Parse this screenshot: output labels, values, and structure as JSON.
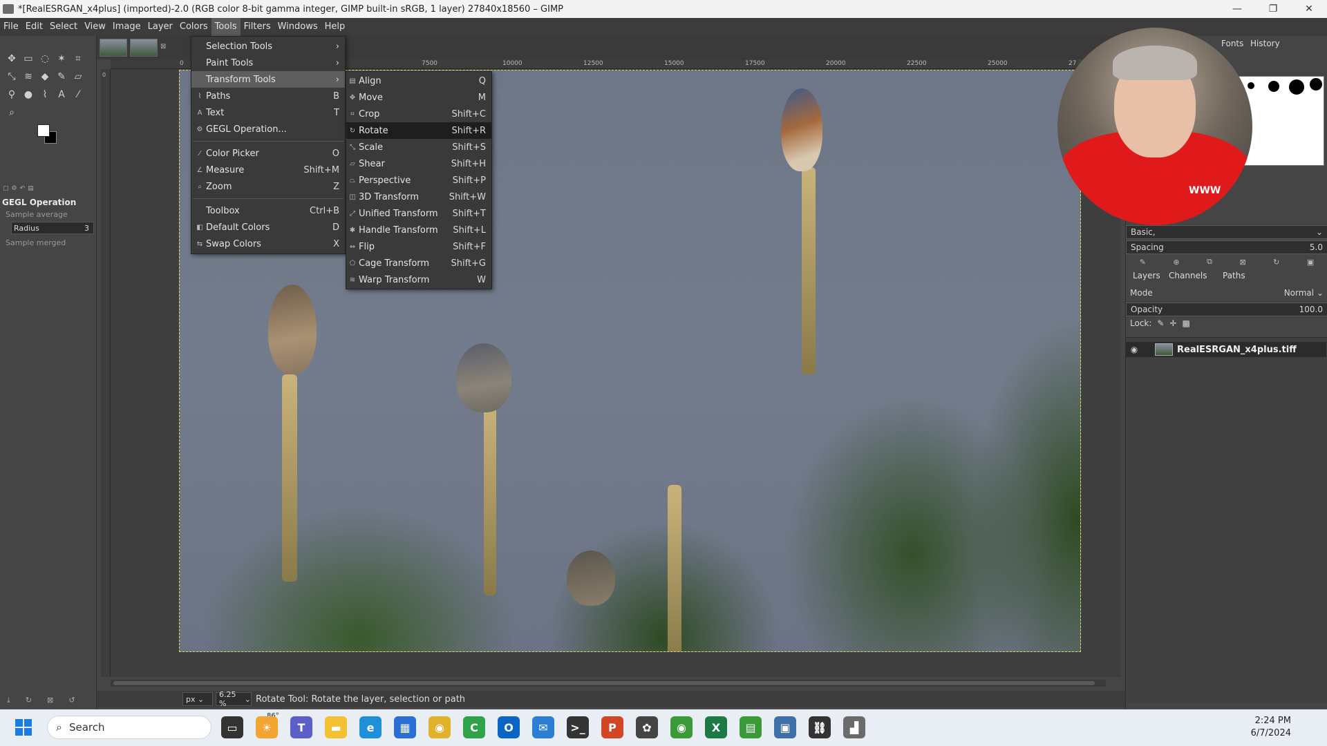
{
  "window": {
    "title": "*[RealESRGAN_x4plus] (imported)-2.0 (RGB color 8-bit gamma integer, GIMP built-in sRGB, 1 layer) 27840x18560 – GIMP",
    "minimize_icon": "minimize-icon",
    "maximize_icon": "restore-icon",
    "close_icon": "close-icon"
  },
  "menubar": [
    "File",
    "Edit",
    "Select",
    "View",
    "Image",
    "Layer",
    "Colors",
    "Tools",
    "Filters",
    "Windows",
    "Help"
  ],
  "tools_menu": {
    "items": [
      {
        "label": "Selection Tools",
        "shortcut": "",
        "submenu": true
      },
      {
        "label": "Paint Tools",
        "shortcut": "",
        "submenu": true
      },
      {
        "label": "Transform Tools",
        "shortcut": "",
        "submenu": true,
        "highlighted": true
      },
      {
        "label": "Paths",
        "shortcut": "B"
      },
      {
        "label": "Text",
        "shortcut": "T"
      },
      {
        "label": "GEGL Operation...",
        "shortcut": ""
      },
      {
        "label": "Color Picker",
        "shortcut": "O"
      },
      {
        "label": "Measure",
        "shortcut": "Shift+M"
      },
      {
        "label": "Zoom",
        "shortcut": "Z"
      },
      {
        "label": "Toolbox",
        "shortcut": "Ctrl+B"
      },
      {
        "label": "Default Colors",
        "shortcut": "D"
      },
      {
        "label": "Swap Colors",
        "shortcut": "X"
      }
    ]
  },
  "transform_menu": {
    "items": [
      {
        "label": "Align",
        "shortcut": "Q"
      },
      {
        "label": "Move",
        "shortcut": "M"
      },
      {
        "label": "Crop",
        "shortcut": "Shift+C"
      },
      {
        "label": "Rotate",
        "shortcut": "Shift+R",
        "highlighted": true
      },
      {
        "label": "Scale",
        "shortcut": "Shift+S"
      },
      {
        "label": "Shear",
        "shortcut": "Shift+H"
      },
      {
        "label": "Perspective",
        "shortcut": "Shift+P"
      },
      {
        "label": "3D Transform",
        "shortcut": "Shift+W"
      },
      {
        "label": "Unified Transform",
        "shortcut": "Shift+T"
      },
      {
        "label": "Handle Transform",
        "shortcut": "Shift+L"
      },
      {
        "label": "Flip",
        "shortcut": "Shift+F"
      },
      {
        "label": "Cage Transform",
        "shortcut": "Shift+G"
      },
      {
        "label": "Warp Transform",
        "shortcut": "W"
      }
    ]
  },
  "tool_options": {
    "title": "GEGL Operation",
    "sample_average": "Sample average",
    "radius_label": "Radius",
    "radius_value": "3",
    "sample_merged": "Sample merged"
  },
  "ruler_ticks": [
    "0",
    "7500",
    "10000",
    "12500",
    "15000",
    "17500",
    "20000",
    "22500",
    "25000",
    "27"
  ],
  "ruler_left_zero": "0",
  "statusbar": {
    "unit": "px",
    "zoom": "6.25 %",
    "message": "Rotate Tool: Rotate the layer, selection or path"
  },
  "right_dock": {
    "tab_fonts": "Fonts",
    "tab_history": "History",
    "brush_preset": "Basic,",
    "spacing_label": "Spacing",
    "spacing_value": "5.0",
    "tab_layers": "Layers",
    "tab_channels": "Channels",
    "tab_paths": "Paths",
    "mode_label": "Mode",
    "mode_value": "Normal",
    "opacity_label": "Opacity",
    "opacity_value": "100.0",
    "lock_label": "Lock:",
    "layer_name": "RealESRGAN_x4plus.tiff"
  },
  "webcam": {
    "shirt_logo": "WWW"
  },
  "taskbar": {
    "search_placeholder": "Search",
    "weather": "86°",
    "time": "2:24 PM",
    "date": "6/7/2024",
    "apps": [
      {
        "name": "task-view-icon",
        "color": "#333333",
        "glyph": "▭"
      },
      {
        "name": "weather-icon",
        "color": "#f3a533",
        "glyph": "☀"
      },
      {
        "name": "teams-icon",
        "color": "#5b5fc7",
        "glyph": "T"
      },
      {
        "name": "file-explorer-icon",
        "color": "#f2c232",
        "glyph": "▬"
      },
      {
        "name": "edge-icon",
        "color": "#1f8fd8",
        "glyph": "e"
      },
      {
        "name": "store-icon",
        "color": "#2a6ed6",
        "glyph": "▦"
      },
      {
        "name": "chrome-icon",
        "color": "#e2b12b",
        "glyph": "◉"
      },
      {
        "name": "camtasia-icon",
        "color": "#2ea34a",
        "glyph": "C"
      },
      {
        "name": "outlook-icon",
        "color": "#0a64c4",
        "glyph": "O"
      },
      {
        "name": "mail-icon",
        "color": "#2a7fd4",
        "glyph": "✉"
      },
      {
        "name": "terminal-icon",
        "color": "#333333",
        "glyph": ">_"
      },
      {
        "name": "powerpoint-icon",
        "color": "#d24625",
        "glyph": "P"
      },
      {
        "name": "resolve-icon",
        "color": "#444444",
        "glyph": "✿"
      },
      {
        "name": "chrome-alt-icon",
        "color": "#3a9a3a",
        "glyph": "◉"
      },
      {
        "name": "excel-icon",
        "color": "#1d7a45",
        "glyph": "X"
      },
      {
        "name": "sheets-icon",
        "color": "#3a9a3a",
        "glyph": "▤"
      },
      {
        "name": "remote-desktop-icon",
        "color": "#3d6fa8",
        "glyph": "▣"
      },
      {
        "name": "link-icon",
        "color": "#333333",
        "glyph": "⛓"
      },
      {
        "name": "gimp-icon",
        "color": "#6b6b6b",
        "glyph": "▟"
      }
    ]
  }
}
